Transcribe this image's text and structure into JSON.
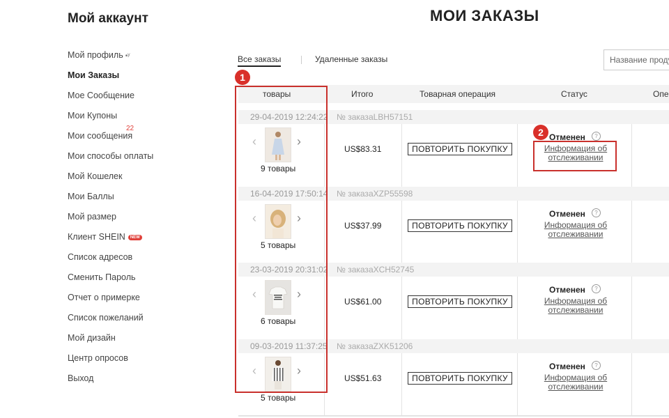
{
  "account": {
    "title": "Мой аккаунт"
  },
  "page": {
    "title": "МОИ ЗАКАЗЫ"
  },
  "sidebar": {
    "items": [
      {
        "label": "Мой профиль",
        "extra": "•ʸ",
        "active": false
      },
      {
        "label": "Мои Заказы",
        "active": true
      },
      {
        "label": "Мое Сообщение",
        "active": false
      },
      {
        "label": "Мои Купоны",
        "active": false
      },
      {
        "label": "Мои сообщения",
        "badge": "22",
        "active": false
      },
      {
        "label": "Мои способы оплаты",
        "active": false
      },
      {
        "label": "Мой Кошелек",
        "active": false
      },
      {
        "label": "Мои Баллы",
        "active": false
      },
      {
        "label": "Мой размер",
        "active": false
      },
      {
        "label": "Клиент SHEIN",
        "tag": "NEW",
        "active": false
      },
      {
        "label": "Список адресов",
        "active": false
      },
      {
        "label": "Сменить Пароль",
        "active": false
      },
      {
        "label": "Отчет о примерке",
        "active": false
      },
      {
        "label": "Список пожеланий",
        "active": false
      },
      {
        "label": "Мой дизайн",
        "active": false
      },
      {
        "label": "Центр опросов",
        "active": false
      },
      {
        "label": "Выход",
        "active": false
      }
    ]
  },
  "tabs": [
    {
      "label": "Все заказы",
      "active": true
    },
    {
      "label": "Удаленные заказы",
      "active": false
    }
  ],
  "search": {
    "placeholder": "Название продукта"
  },
  "table": {
    "headers": [
      "товары",
      "Итого",
      "Товарная операция",
      "Статус",
      "Опе"
    ]
  },
  "orders": [
    {
      "date": "29-04-2019 12:24:22",
      "number": "№ заказаLBH57151",
      "qty": "9 товары",
      "total": "US$83.31",
      "action": "ПОВТОРИТЬ ПОКУПКУ",
      "status": "Отменен",
      "tracking": "Информация об отслеживании",
      "help": "?"
    },
    {
      "date": "16-04-2019 17:50:14",
      "number": "№ заказаXZP55598",
      "qty": "5 товары",
      "total": "US$37.99",
      "action": "ПОВТОРИТЬ ПОКУПКУ",
      "status": "Отменен",
      "tracking": "Информация об отслеживании",
      "help": "?"
    },
    {
      "date": "23-03-2019 20:31:02",
      "number": "№ заказаXCH52745",
      "qty": "6 товары",
      "total": "US$61.00",
      "action": "ПОВТОРИТЬ ПОКУПКУ",
      "status": "Отменен",
      "tracking": "Информация об отслеживании",
      "help": "?"
    },
    {
      "date": "09-03-2019 11:37:25",
      "number": "№ заказаZXK51206",
      "qty": "5 товары",
      "total": "US$51.63",
      "action": "ПОВТОРИТЬ ПОКУПКУ",
      "status": "Отменен",
      "tracking": "Информация об отслеживании",
      "help": "?"
    }
  ],
  "annotations": [
    {
      "label": "1",
      "color": "#d9302a"
    },
    {
      "label": "2",
      "color": "#d9302a"
    }
  ],
  "icons": {
    "arrow_left": "‹",
    "arrow_right": "›",
    "thumbnails": [
      "dress-thumbnail",
      "hair-portrait-thumbnail",
      "tshirt-thumbnail",
      "striped-top-thumbnail"
    ]
  }
}
